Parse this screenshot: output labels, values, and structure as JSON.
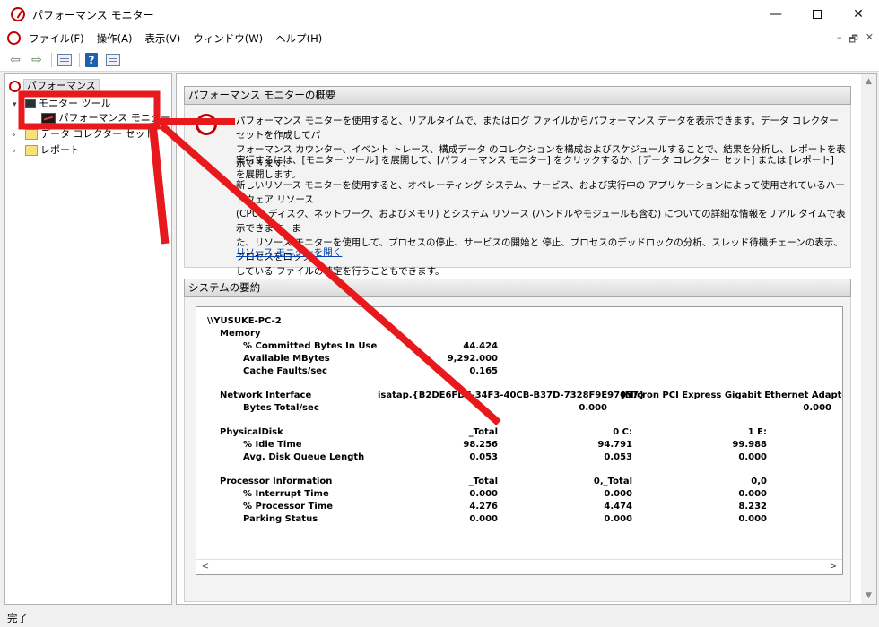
{
  "window": {
    "title": "パフォーマンス モニター",
    "controls": {
      "minimize": "—",
      "maximize": "",
      "close": "✕"
    }
  },
  "menu": {
    "items": [
      "ファイル(F)",
      "操作(A)",
      "表示(V)",
      "ウィンドウ(W)",
      "ヘルプ(H)"
    ],
    "mdi": {
      "minimize": "–",
      "restore": "🗗",
      "close": "✕"
    }
  },
  "toolbar": {
    "back": "⇦",
    "forward": "⇨",
    "help": "?"
  },
  "tree": {
    "root": "パフォーマンス",
    "monitor_tools": "モニター ツール",
    "perf_monitor": "パフォーマンス モニター",
    "data_collector": "データ コレクター セット",
    "reports": "レポート"
  },
  "overview": {
    "header": "パフォーマンス モニターの概要",
    "para1_line1": "パフォーマンス モニターを使用すると、リアルタイムで、またはログ ファイルからパフォーマンス データを表示できます。データ コレクター セットを作成してパ",
    "para1_line2": "フォーマンス カウンター、イベント トレース、構成データ のコレクションを構成およびスケジュールすることで、結果を分析し、レポートを表示できます。",
    "para2": "実行するには、[モニター ツール] を展開して、[パフォーマンス モニター] をクリックするか、[データ コレクター セット] または [レポート] を展開します。",
    "para3_line1": "新しいリソース モニターを使用すると、オペレーティング システム、サービス、および実行中の アプリケーションによって使用されているハードウェア リソース",
    "para3_line2": "(CPU、ディスク、ネットワーク、およびメモリ) とシステム リソース (ハンドルやモジュールも含む) についての詳細な情報をリアル タイムで表示できます。ま",
    "para3_line3": "た、リソース モニターを使用して、プロセスの停止、サービスの開始と 停止、プロセスのデッドロックの分析、スレッド待機チェーンの表示、プロセスをロック",
    "para3_line4": "している ファイルの特定を行うこともできます。",
    "link": "リソース モニターを開く"
  },
  "summary": {
    "header": "システムの要約",
    "host": "\\\\YUSUKE-PC-2",
    "memory": {
      "title": "Memory",
      "rows": [
        {
          "label": "% Committed Bytes In Use",
          "value": "44.424"
        },
        {
          "label": "Available MBytes",
          "value": "9,292.000"
        },
        {
          "label": "Cache Faults/sec",
          "value": "0.165"
        }
      ]
    },
    "network": {
      "title": "Network Interface",
      "instances": [
        "isatap.{B2DE6FD7-34F3-40CB-B37D-7328F9E97057}",
        "JMicron PCI Express Gigabit Ethernet Adapter"
      ],
      "rows": [
        {
          "label": "Bytes Total/sec",
          "values": [
            "0.000",
            "0.000"
          ]
        }
      ]
    },
    "disk": {
      "title": "PhysicalDisk",
      "instances": [
        "_Total",
        "0 C:",
        "1 E:"
      ],
      "rows": [
        {
          "label": "% Idle Time",
          "values": [
            "98.256",
            "94.791",
            "99.988"
          ]
        },
        {
          "label": "Avg. Disk Queue Length",
          "values": [
            "0.053",
            "0.053",
            "0.000"
          ]
        }
      ]
    },
    "processor": {
      "title": "Processor Information",
      "instances": [
        "_Total",
        "0,_Total",
        "0,0"
      ],
      "rows": [
        {
          "label": "% Interrupt Time",
          "values": [
            "0.000",
            "0.000",
            "0.000"
          ]
        },
        {
          "label": "% Processor Time",
          "values": [
            "4.276",
            "4.474",
            "8.232"
          ]
        },
        {
          "label": "Parking Status",
          "values": [
            "0.000",
            "0.000",
            "0.000"
          ]
        }
      ]
    },
    "scroll_left": "<",
    "scroll_right": ">"
  },
  "vscroll": {
    "up": "▲",
    "down": "▼"
  },
  "status": {
    "text": "完了"
  },
  "colors": {
    "annotation": "#e8191c",
    "link": "#0645ad",
    "brand": "#c00000"
  }
}
